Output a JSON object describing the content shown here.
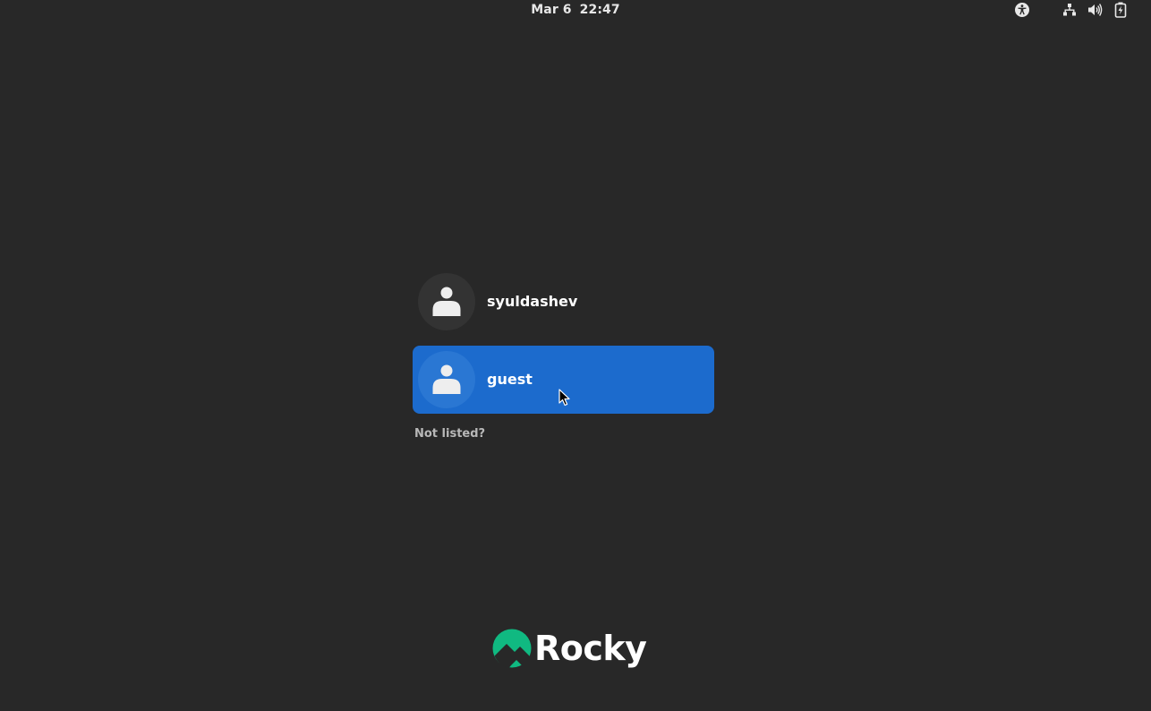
{
  "topbar": {
    "date": "Mar 6",
    "time": "22:47",
    "tray": {
      "accessibility_icon": "accessibility-icon",
      "network_icon": "network-wired-icon",
      "volume_icon": "volume-icon",
      "battery_icon": "battery-charging-icon"
    }
  },
  "users": [
    {
      "name": "syuldashev",
      "avatar_icon": "person-icon",
      "selected": false
    },
    {
      "name": "guest",
      "avatar_icon": "person-icon",
      "selected": true
    }
  ],
  "not_listed_label": "Not listed?",
  "branding": {
    "logo_text": "Rocky",
    "logo_icon": "rocky-mountain-icon",
    "logo_color": "#10b981"
  },
  "colors": {
    "background": "#282828",
    "selected_row": "#1c6bcd"
  }
}
